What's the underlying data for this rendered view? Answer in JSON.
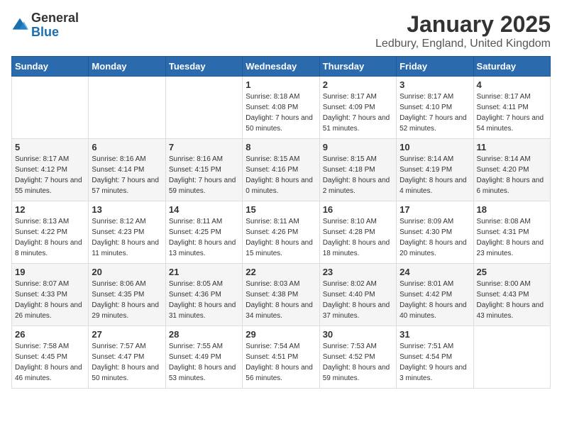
{
  "logo": {
    "general": "General",
    "blue": "Blue"
  },
  "title": "January 2025",
  "subtitle": "Ledbury, England, United Kingdom",
  "days_of_week": [
    "Sunday",
    "Monday",
    "Tuesday",
    "Wednesday",
    "Thursday",
    "Friday",
    "Saturday"
  ],
  "rows": [
    [
      {
        "day": "",
        "info": ""
      },
      {
        "day": "",
        "info": ""
      },
      {
        "day": "",
        "info": ""
      },
      {
        "day": "1",
        "info": "Sunrise: 8:18 AM\nSunset: 4:08 PM\nDaylight: 7 hours and 50 minutes."
      },
      {
        "day": "2",
        "info": "Sunrise: 8:17 AM\nSunset: 4:09 PM\nDaylight: 7 hours and 51 minutes."
      },
      {
        "day": "3",
        "info": "Sunrise: 8:17 AM\nSunset: 4:10 PM\nDaylight: 7 hours and 52 minutes."
      },
      {
        "day": "4",
        "info": "Sunrise: 8:17 AM\nSunset: 4:11 PM\nDaylight: 7 hours and 54 minutes."
      }
    ],
    [
      {
        "day": "5",
        "info": "Sunrise: 8:17 AM\nSunset: 4:12 PM\nDaylight: 7 hours and 55 minutes."
      },
      {
        "day": "6",
        "info": "Sunrise: 8:16 AM\nSunset: 4:14 PM\nDaylight: 7 hours and 57 minutes."
      },
      {
        "day": "7",
        "info": "Sunrise: 8:16 AM\nSunset: 4:15 PM\nDaylight: 7 hours and 59 minutes."
      },
      {
        "day": "8",
        "info": "Sunrise: 8:15 AM\nSunset: 4:16 PM\nDaylight: 8 hours and 0 minutes."
      },
      {
        "day": "9",
        "info": "Sunrise: 8:15 AM\nSunset: 4:18 PM\nDaylight: 8 hours and 2 minutes."
      },
      {
        "day": "10",
        "info": "Sunrise: 8:14 AM\nSunset: 4:19 PM\nDaylight: 8 hours and 4 minutes."
      },
      {
        "day": "11",
        "info": "Sunrise: 8:14 AM\nSunset: 4:20 PM\nDaylight: 8 hours and 6 minutes."
      }
    ],
    [
      {
        "day": "12",
        "info": "Sunrise: 8:13 AM\nSunset: 4:22 PM\nDaylight: 8 hours and 8 minutes."
      },
      {
        "day": "13",
        "info": "Sunrise: 8:12 AM\nSunset: 4:23 PM\nDaylight: 8 hours and 11 minutes."
      },
      {
        "day": "14",
        "info": "Sunrise: 8:11 AM\nSunset: 4:25 PM\nDaylight: 8 hours and 13 minutes."
      },
      {
        "day": "15",
        "info": "Sunrise: 8:11 AM\nSunset: 4:26 PM\nDaylight: 8 hours and 15 minutes."
      },
      {
        "day": "16",
        "info": "Sunrise: 8:10 AM\nSunset: 4:28 PM\nDaylight: 8 hours and 18 minutes."
      },
      {
        "day": "17",
        "info": "Sunrise: 8:09 AM\nSunset: 4:30 PM\nDaylight: 8 hours and 20 minutes."
      },
      {
        "day": "18",
        "info": "Sunrise: 8:08 AM\nSunset: 4:31 PM\nDaylight: 8 hours and 23 minutes."
      }
    ],
    [
      {
        "day": "19",
        "info": "Sunrise: 8:07 AM\nSunset: 4:33 PM\nDaylight: 8 hours and 26 minutes."
      },
      {
        "day": "20",
        "info": "Sunrise: 8:06 AM\nSunset: 4:35 PM\nDaylight: 8 hours and 29 minutes."
      },
      {
        "day": "21",
        "info": "Sunrise: 8:05 AM\nSunset: 4:36 PM\nDaylight: 8 hours and 31 minutes."
      },
      {
        "day": "22",
        "info": "Sunrise: 8:03 AM\nSunset: 4:38 PM\nDaylight: 8 hours and 34 minutes."
      },
      {
        "day": "23",
        "info": "Sunrise: 8:02 AM\nSunset: 4:40 PM\nDaylight: 8 hours and 37 minutes."
      },
      {
        "day": "24",
        "info": "Sunrise: 8:01 AM\nSunset: 4:42 PM\nDaylight: 8 hours and 40 minutes."
      },
      {
        "day": "25",
        "info": "Sunrise: 8:00 AM\nSunset: 4:43 PM\nDaylight: 8 hours and 43 minutes."
      }
    ],
    [
      {
        "day": "26",
        "info": "Sunrise: 7:58 AM\nSunset: 4:45 PM\nDaylight: 8 hours and 46 minutes."
      },
      {
        "day": "27",
        "info": "Sunrise: 7:57 AM\nSunset: 4:47 PM\nDaylight: 8 hours and 50 minutes."
      },
      {
        "day": "28",
        "info": "Sunrise: 7:55 AM\nSunset: 4:49 PM\nDaylight: 8 hours and 53 minutes."
      },
      {
        "day": "29",
        "info": "Sunrise: 7:54 AM\nSunset: 4:51 PM\nDaylight: 8 hours and 56 minutes."
      },
      {
        "day": "30",
        "info": "Sunrise: 7:53 AM\nSunset: 4:52 PM\nDaylight: 8 hours and 59 minutes."
      },
      {
        "day": "31",
        "info": "Sunrise: 7:51 AM\nSunset: 4:54 PM\nDaylight: 9 hours and 3 minutes."
      },
      {
        "day": "",
        "info": ""
      }
    ]
  ]
}
